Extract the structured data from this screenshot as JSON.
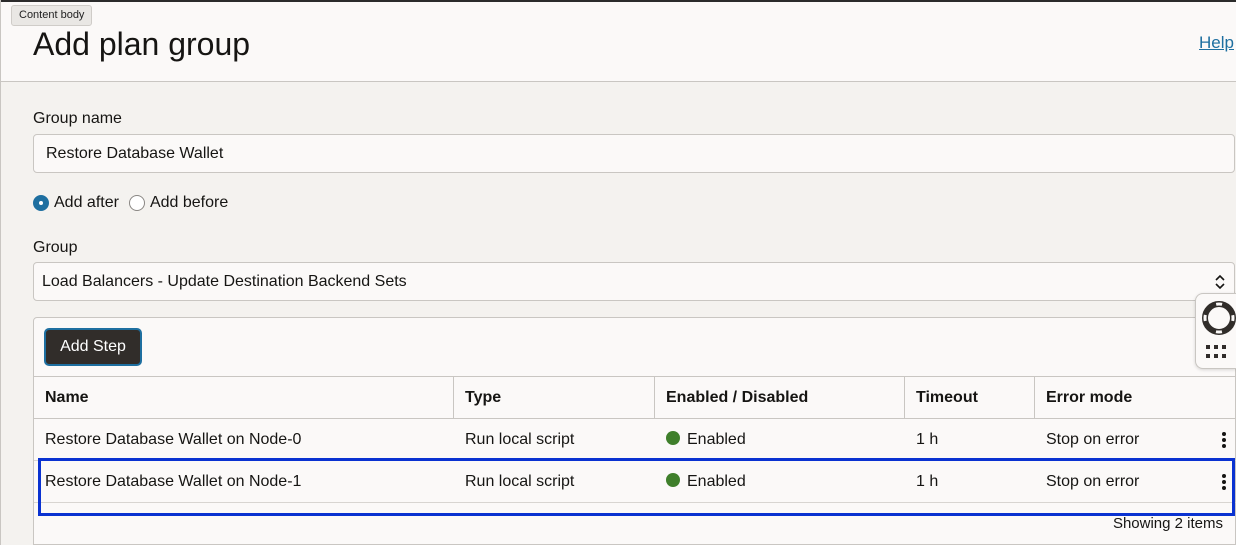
{
  "tooltip": "Content body",
  "header": {
    "title": "Add plan group",
    "help_label": "Help"
  },
  "form": {
    "group_name_label": "Group name",
    "group_name_value": "Restore Database Wallet",
    "position_options": [
      {
        "label": "Add after",
        "checked": true
      },
      {
        "label": "Add before",
        "checked": false
      }
    ],
    "group_label": "Group",
    "group_selected": "Load Balancers - Update Destination Backend Sets"
  },
  "steps": {
    "add_step_label": "Add Step",
    "columns": [
      "Name",
      "Type",
      "Enabled / Disabled",
      "Timeout",
      "Error mode"
    ],
    "rows": [
      {
        "name": "Restore Database Wallet on Node-0",
        "type": "Run local script",
        "status": "Enabled",
        "timeout": "1 h",
        "error_mode": "Stop on error"
      },
      {
        "name": "Restore Database Wallet on Node-1",
        "type": "Run local script",
        "status": "Enabled",
        "timeout": "1 h",
        "error_mode": "Stop on error"
      }
    ],
    "footer": "Showing 2 items"
  },
  "colors": {
    "accent": "#1e6fa0",
    "enabled": "#3f7f2b",
    "highlight": "#0a32d1",
    "button_bg": "#312d2a"
  },
  "icons": {
    "side_widget": [
      "lifebuoy-icon",
      "grid-icon"
    ],
    "row_menu": "kebab-menu-icon",
    "select": "chevron-updown-icon"
  }
}
